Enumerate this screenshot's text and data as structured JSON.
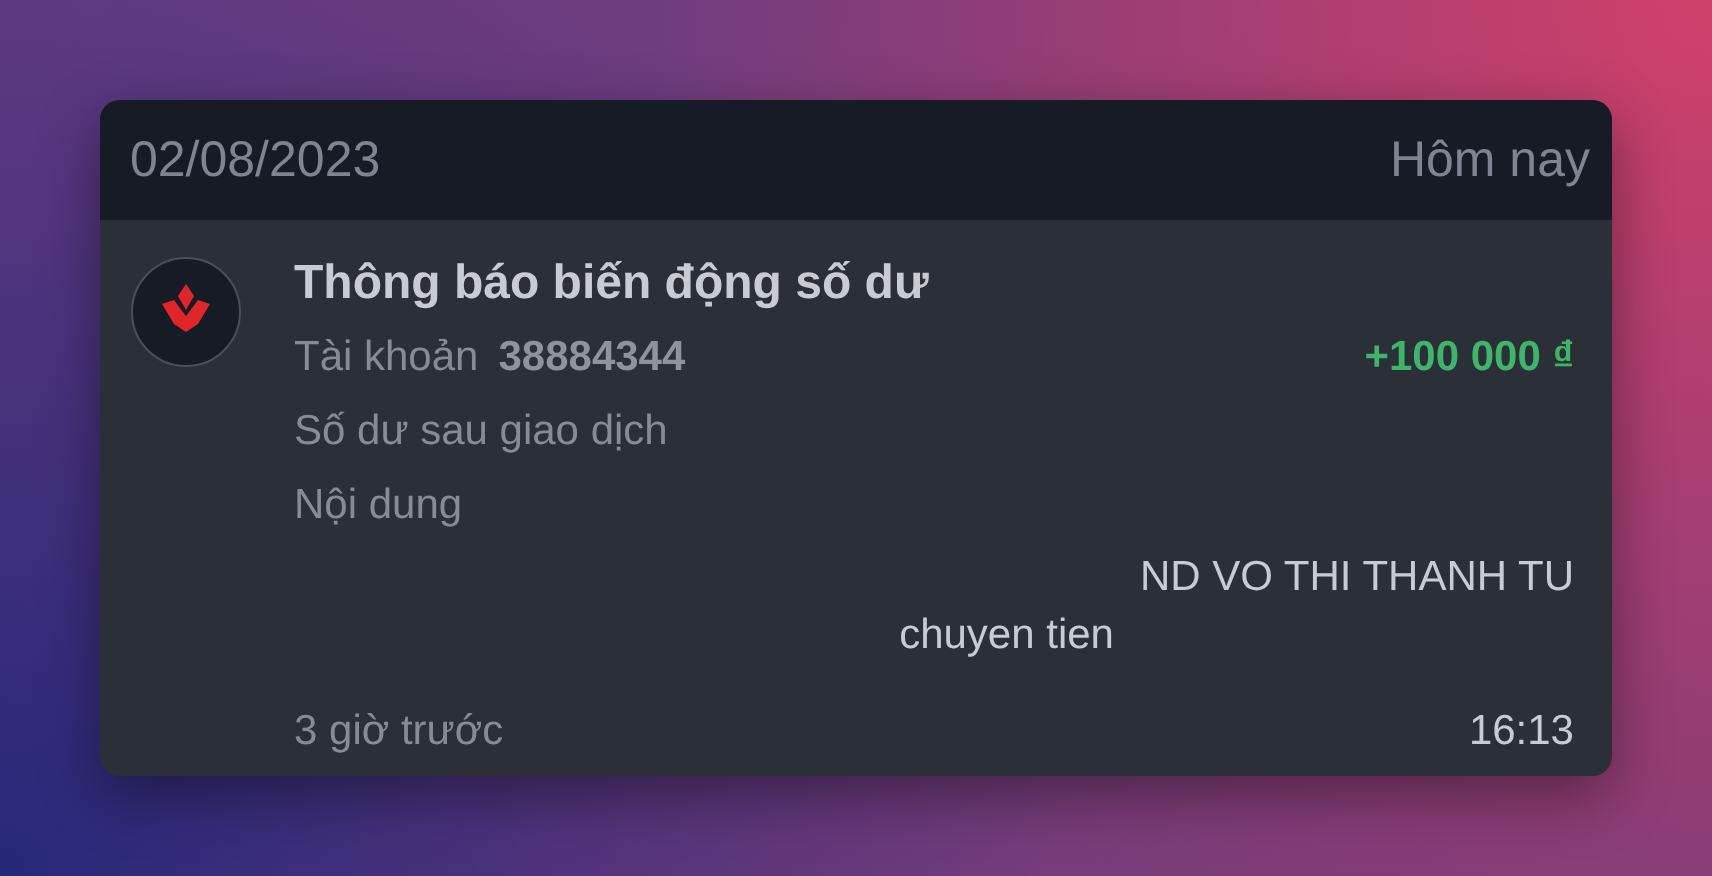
{
  "header": {
    "date": "02/08/2023",
    "day": "Hôm nay"
  },
  "notification": {
    "title": "Thông báo biến động số dư",
    "account_label": "Tài khoản",
    "account_number": "38884344",
    "amount": "+100 000 ₫",
    "balance_label": "Số dư sau giao dịch",
    "content_label": "Nội dung",
    "content_lines": [
      "ND VO THI THANH TU",
      "chuyen tien"
    ],
    "elapsed": "3 giờ trước",
    "time": "16:13"
  }
}
